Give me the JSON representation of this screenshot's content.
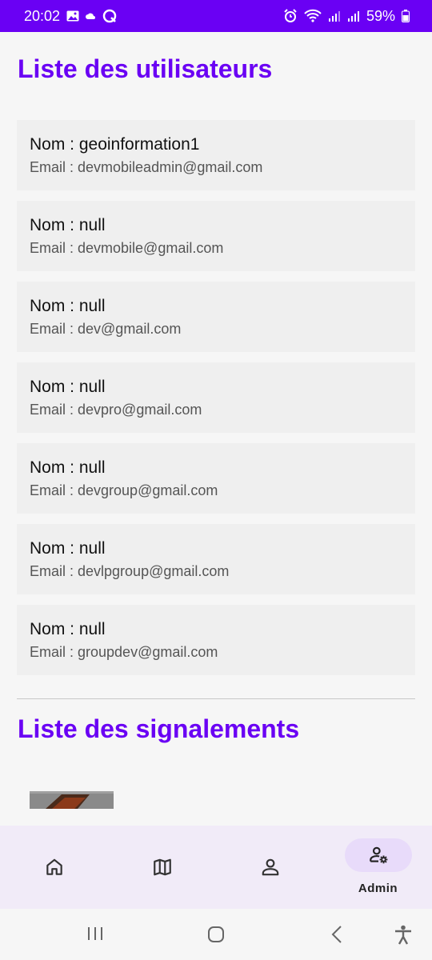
{
  "status_bar": {
    "time": "20:02",
    "battery": "59%"
  },
  "users_section": {
    "title": "Liste des utilisateurs",
    "users": [
      {
        "name": "Nom : geoinformation1",
        "email": "Email : devmobileadmin@gmail.com"
      },
      {
        "name": "Nom : null",
        "email": "Email : devmobile@gmail.com"
      },
      {
        "name": "Nom : null",
        "email": "Email : dev@gmail.com"
      },
      {
        "name": "Nom : null",
        "email": "Email : devpro@gmail.com"
      },
      {
        "name": "Nom : null",
        "email": "Email : devgroup@gmail.com"
      },
      {
        "name": "Nom : null",
        "email": "Email : devlpgroup@gmail.com"
      },
      {
        "name": "Nom : null",
        "email": "Email : groupdev@gmail.com"
      }
    ]
  },
  "reports_section": {
    "title": "Liste des signalements"
  },
  "bottom_nav": {
    "items": [
      {
        "icon": "home-icon",
        "label": ""
      },
      {
        "icon": "map-icon",
        "label": ""
      },
      {
        "icon": "person-icon",
        "label": ""
      },
      {
        "icon": "admin-icon",
        "label": "Admin",
        "selected": true
      }
    ]
  },
  "colors": {
    "accent": "#6a00f4",
    "nav_background": "#f1ebf8",
    "nav_selected_pill": "#e8dbfa",
    "card_background": "#efefef"
  }
}
